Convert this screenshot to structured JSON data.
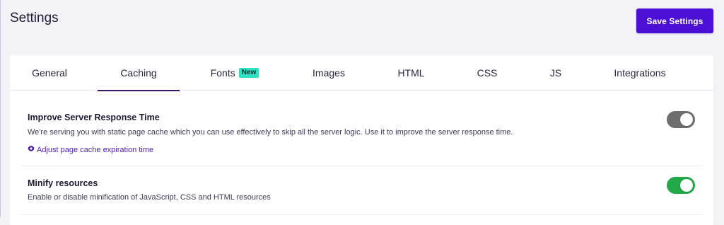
{
  "header": {
    "title": "Settings",
    "save_label": "Save Settings"
  },
  "tabs": [
    {
      "label": "General",
      "active": false
    },
    {
      "label": "Caching",
      "active": true
    },
    {
      "label": "Fonts",
      "active": false,
      "badge": "New"
    },
    {
      "label": "Images",
      "active": false
    },
    {
      "label": "HTML",
      "active": false
    },
    {
      "label": "CSS",
      "active": false
    },
    {
      "label": "JS",
      "active": false
    },
    {
      "label": "Integrations",
      "active": false
    }
  ],
  "settings": [
    {
      "title": "Improve Server Response Time",
      "description": "We're serving you with static page cache which you can use effectively to skip all the server logic. Use it to improve the server response time.",
      "link": "Adjust page cache expiration time",
      "link_icon": "gear-icon",
      "enabled": false
    },
    {
      "title": "Minify resources",
      "description": "Enable or disable minification of JavaScript, CSS and HTML resources",
      "enabled": true
    }
  ],
  "colors": {
    "accent": "#4b0fd6",
    "toggle_on": "#23a94a",
    "toggle_off": "#6e6e6e",
    "badge": "#2ee0c4",
    "active_tab_underline": "#3b1470"
  }
}
